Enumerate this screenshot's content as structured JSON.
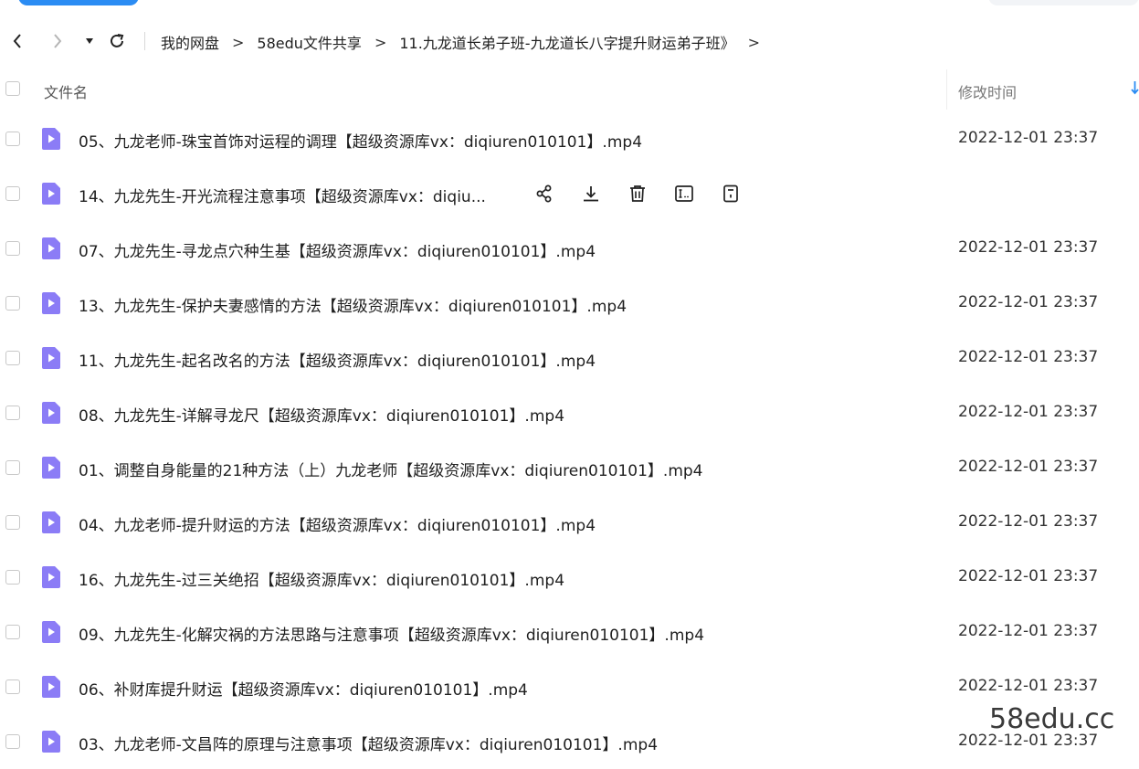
{
  "navbar": {
    "breadcrumb": [
      "我的网盘",
      "58edu文件共享",
      "11.九龙道长弟子班-九龙道长八字提升财运弟子班》"
    ],
    "separator": ">"
  },
  "list_header": {
    "name_label": "文件名",
    "time_label": "修改时间"
  },
  "files": [
    {
      "name": "05、九龙老师-珠宝首饰对运程的调理【超级资源库vx：diqiuren010101】.mp4",
      "time": "2022-12-01 23:37"
    },
    {
      "name": "14、九龙先生-开光流程注意事项【超级资源库vx：diqiu...",
      "time": ""
    },
    {
      "name": "07、九龙先生-寻龙点穴种生基【超级资源库vx：diqiuren010101】.mp4",
      "time": "2022-12-01 23:37"
    },
    {
      "name": "13、九龙先生-保护夫妻感情的方法【超级资源库vx：diqiuren010101】.mp4",
      "time": "2022-12-01 23:37"
    },
    {
      "name": "11、九龙先生-起名改名的方法【超级资源库vx：diqiuren010101】.mp4",
      "time": "2022-12-01 23:37"
    },
    {
      "name": "08、九龙先生-详解寻龙尺【超级资源库vx：diqiuren010101】.mp4",
      "time": "2022-12-01 23:37"
    },
    {
      "name": "01、调整自身能量的21种方法（上）九龙老师【超级资源库vx：diqiuren010101】.mp4",
      "time": "2022-12-01 23:37"
    },
    {
      "name": "04、九龙老师-提升财运的方法【超级资源库vx：diqiuren010101】.mp4",
      "time": "2022-12-01 23:37"
    },
    {
      "name": "16、九龙先生-过三关绝招【超级资源库vx：diqiuren010101】.mp4",
      "time": "2022-12-01 23:37"
    },
    {
      "name": "09、九龙先生-化解灾祸的方法思路与注意事项【超级资源库vx：diqiuren010101】.mp4",
      "time": "2022-12-01 23:37"
    },
    {
      "name": "06、补财库提升财运【超级资源库vx：diqiuren010101】.mp4",
      "time": "2022-12-01 23:37"
    },
    {
      "name": "03、九龙老师-文昌阵的原理与注意事项【超级资源库vx：diqiuren010101】.mp4",
      "time": "2022-12-01 23:37"
    }
  ],
  "hover_row_index": 1,
  "hover_actions": [
    "share-icon",
    "download-icon",
    "delete-icon",
    "rename-icon",
    "more-icon"
  ],
  "watermark": "58edu.cc",
  "colors": {
    "accent": "#2b8cf3",
    "file_icon": "#8b7cf6"
  }
}
